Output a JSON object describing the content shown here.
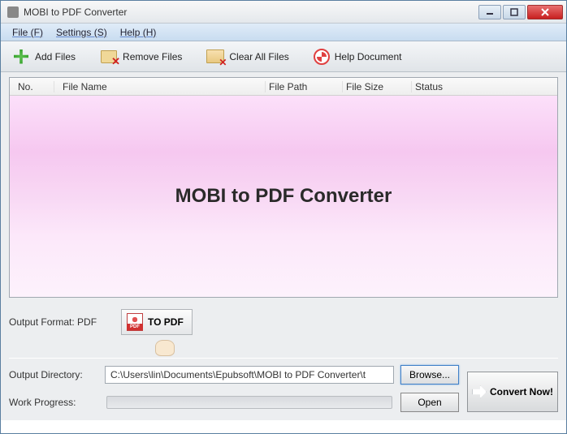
{
  "window": {
    "title": "MOBI to PDF Converter"
  },
  "menu": {
    "file": "File (F)",
    "settings": "Settings (S)",
    "help": "Help (H)"
  },
  "toolbar": {
    "add": "Add Files",
    "remove": "Remove Files",
    "clear": "Clear All Files",
    "help": "Help Document"
  },
  "columns": {
    "no": "No.",
    "name": "File Name",
    "path": "File Path",
    "size": "File Size",
    "status": "Status"
  },
  "watermark": "MOBI to PDF Converter",
  "output": {
    "format_label": "Output Format: PDF",
    "format_button": "TO PDF",
    "dir_label": "Output Directory:",
    "dir_value": "C:\\Users\\lin\\Documents\\Epubsoft\\MOBI to PDF Converter\\t",
    "browse": "Browse...",
    "open": "Open"
  },
  "progress": {
    "label": "Work Progress:"
  },
  "convert": {
    "label": "Convert Now!"
  }
}
